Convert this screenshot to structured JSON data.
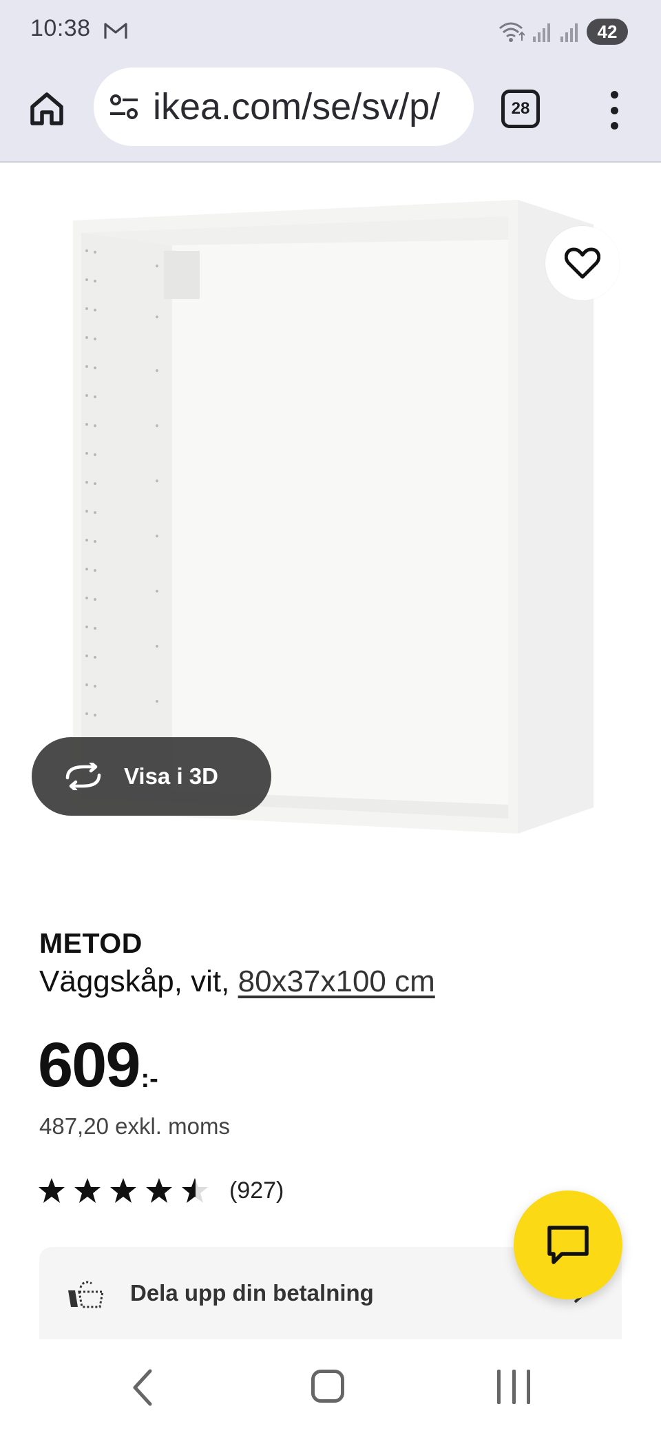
{
  "status_bar": {
    "time": "10:38",
    "battery": "42",
    "icons": [
      "gmail-icon",
      "wifi-icon",
      "signal-icon",
      "signal-icon"
    ]
  },
  "browser": {
    "url": "ikea.com/se/sv/p/",
    "tab_count": "28",
    "icons": [
      "home-icon",
      "tune-icon",
      "more-vert-icon"
    ]
  },
  "product": {
    "view_3d_label": "Visa i 3D",
    "name": "METOD",
    "description_prefix": "Väggskåp, vit, ",
    "size_link": "80x37x100 cm",
    "price": "609",
    "price_suffix": ":-",
    "price_excl_vat": "487,20 exkl. moms",
    "rating": 4.5,
    "rating_max": 5,
    "review_count": "(927)",
    "payment_label": "Dela upp din betalning"
  },
  "colors": {
    "accent_yellow": "#fbd914",
    "browser_chrome": "#e7e7f2",
    "overlay_dark": "#3c3c3c"
  }
}
